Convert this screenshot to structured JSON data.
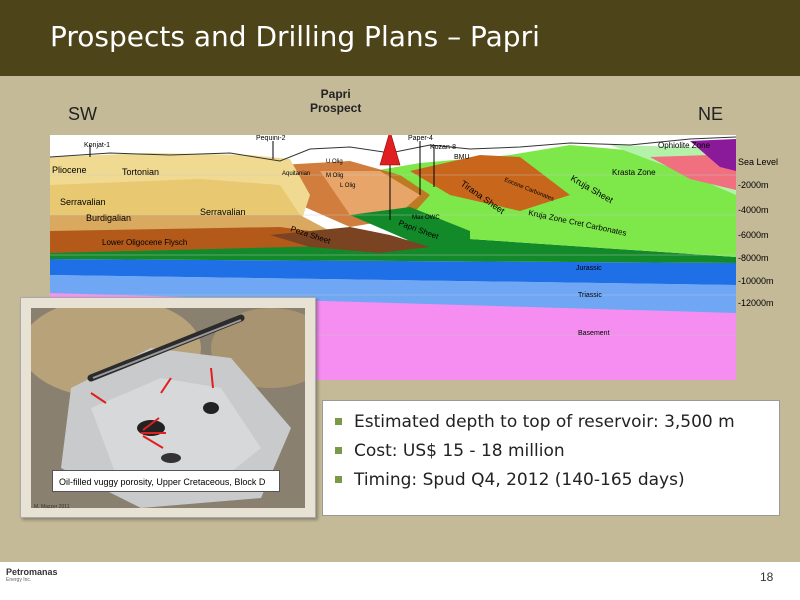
{
  "slide": {
    "title": "Prospects and Drilling Plans – Papri",
    "page_number": "18"
  },
  "section": {
    "dir_left": "SW",
    "dir_right": "NE",
    "prospect_line1": "Papri",
    "prospect_line2": "Prospect",
    "wells": [
      "Konjat-1",
      "Pequini-2",
      "Paper-4",
      "Kozan-8"
    ],
    "zones": {
      "ophiolite": "Ophiolite Zone",
      "krasta": "Krasta Zone",
      "kruja_sheet": "Kruja Sheet",
      "eocene": "Eocene Carbonates",
      "kruja_cret": "Kruja Zone Cret Carbonates",
      "tirana": "Tirana Sheet",
      "papri_sheet": "Papri Sheet",
      "peza": "Peza Sheet",
      "max_owc": "Max OWC",
      "jurassic": "Jurassic",
      "triassic": "Triassic",
      "basement": "Basement",
      "pliocene": "Pliocene",
      "tortonian": "Tortonian",
      "serravalian": "Serravalian",
      "burdigalian": "Burdigalian",
      "serravalian2": "Serravalian",
      "lower_olig": "Lower Oligocene Flysch",
      "bmu": "BMU",
      "aquitanian": "Aquitanian",
      "u_olig": "U Olig",
      "m_olig": "M Olig",
      "l_olig": "L Olig"
    },
    "depth_scale": [
      "Sea Level",
      "-2000m",
      "-4000m",
      "-6000m",
      "-8000m",
      "-10000m",
      "-12000m"
    ]
  },
  "photo": {
    "caption": "Oil-filled vuggy porosity, Upper Cretaceous, Block D",
    "credit": "M. Mazzer 2011"
  },
  "bullets": [
    "Estimated depth to top of reservoir: 3,500 m",
    "Cost: US$ 15 - 18 million",
    "Timing: Spud Q4, 2012 (140-165 days)"
  ],
  "company": {
    "name": "Petromanas",
    "sub": "Energy Inc."
  },
  "colors": {
    "title_bar": "#4d4419",
    "background": "#c4ba98",
    "bullet_accent": "#7a9a4a"
  }
}
